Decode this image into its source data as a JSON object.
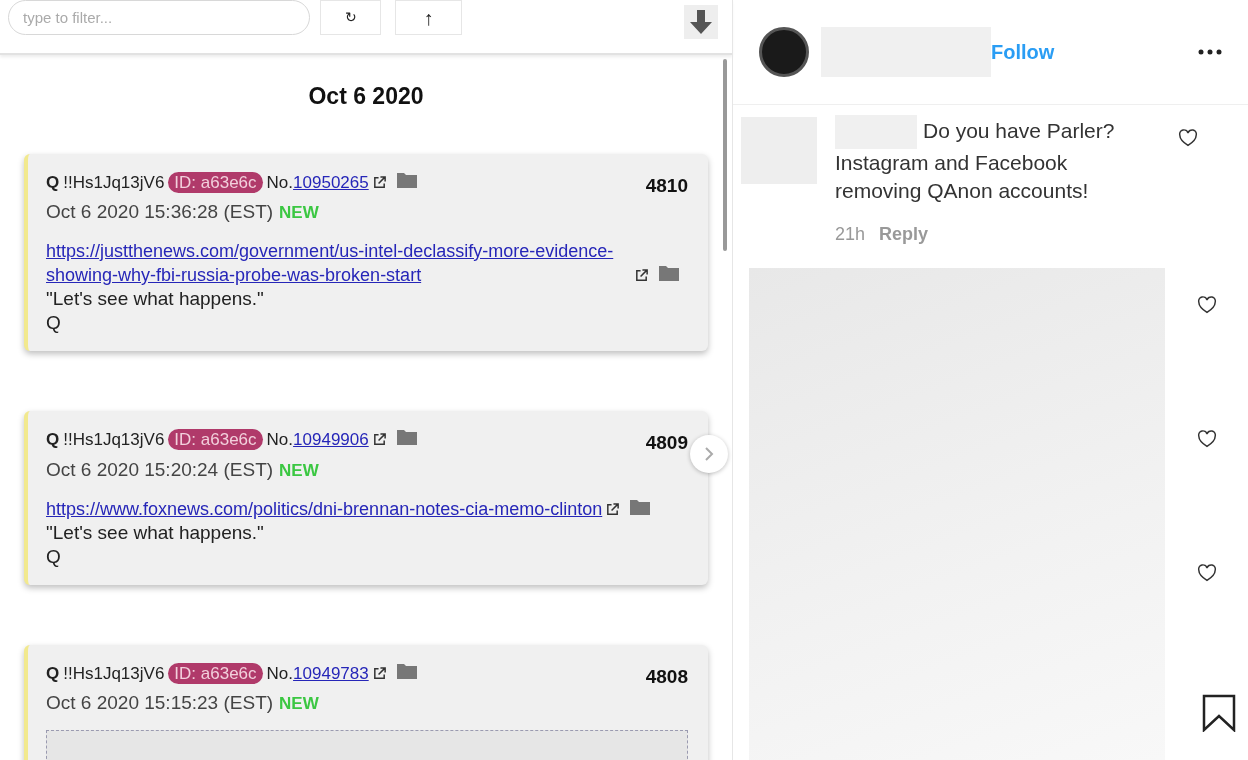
{
  "filter": {
    "placeholder": "type to filter..."
  },
  "toolbar_buttons": [
    "↻",
    "↑"
  ],
  "date_heading": "Oct 6 2020",
  "posts": [
    {
      "name": "Q",
      "trip": "!!Hs1Jq13jV6",
      "id": "ID: a63e6c",
      "no_label": "No.",
      "no": "10950265",
      "count": "4810",
      "time": "Oct 6 2020 15:36:28 (EST)",
      "badge": "NEW",
      "link": "https://justthenews.com/government/us-intel-declassify-more-evidence-showing-why-fbi-russia-probe-was-broken-start",
      "lines": [
        "\"Let's see what happens.\"",
        "Q"
      ],
      "attachment": false,
      "next_button": false
    },
    {
      "name": "Q",
      "trip": "!!Hs1Jq13jV6",
      "id": "ID: a63e6c",
      "no_label": "No.",
      "no": "10949906",
      "count": "4809",
      "time": "Oct 6 2020 15:20:24 (EST)",
      "badge": "NEW",
      "link": "https://www.foxnews.com/politics/dni-brennan-notes-cia-memo-clinton",
      "lines": [
        "\"Let's see what happens.\"",
        "Q"
      ],
      "attachment": false,
      "next_button": true
    },
    {
      "name": "Q",
      "trip": "!!Hs1Jq13jV6",
      "id": "ID: a63e6c",
      "no_label": "No.",
      "no": "10949783",
      "count": "4808",
      "time": "Oct 6 2020 15:15:23 (EST)",
      "badge": "NEW",
      "attachment": true,
      "next_button": false
    }
  ],
  "profile": {
    "follow": "Follow"
  },
  "comment": {
    "text": "Do you have Parler? Instagram and Facebook removing QAnon accounts!",
    "time": "21h",
    "reply": "Reply"
  }
}
